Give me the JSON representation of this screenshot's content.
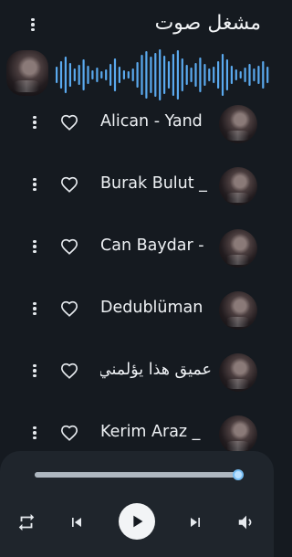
{
  "header": {
    "title": "مشغل صوت"
  },
  "now_playing": {
    "art": "singer-avatar",
    "waveform": "audio-waveform"
  },
  "tracks": [
    {
      "label": "Alican - Yand",
      "rtl": false
    },
    {
      "label": "Burak Bulut _",
      "rtl": false
    },
    {
      "label": "Can Baydar -",
      "rtl": false
    },
    {
      "label": "Dedublüman",
      "rtl": false
    },
    {
      "label": "عميق هذا يؤلمني",
      "rtl": true
    },
    {
      "label": "Kerim Araz _",
      "rtl": false
    }
  ],
  "player": {
    "progress": 0.985,
    "controls": [
      "repeat-icon",
      "skip-previous-icon",
      "play-icon",
      "skip-next-icon",
      "speaker-icon"
    ]
  },
  "colors": {
    "accent": "#5aa9ee",
    "background": "#151a20",
    "panel": "#1f252c"
  }
}
